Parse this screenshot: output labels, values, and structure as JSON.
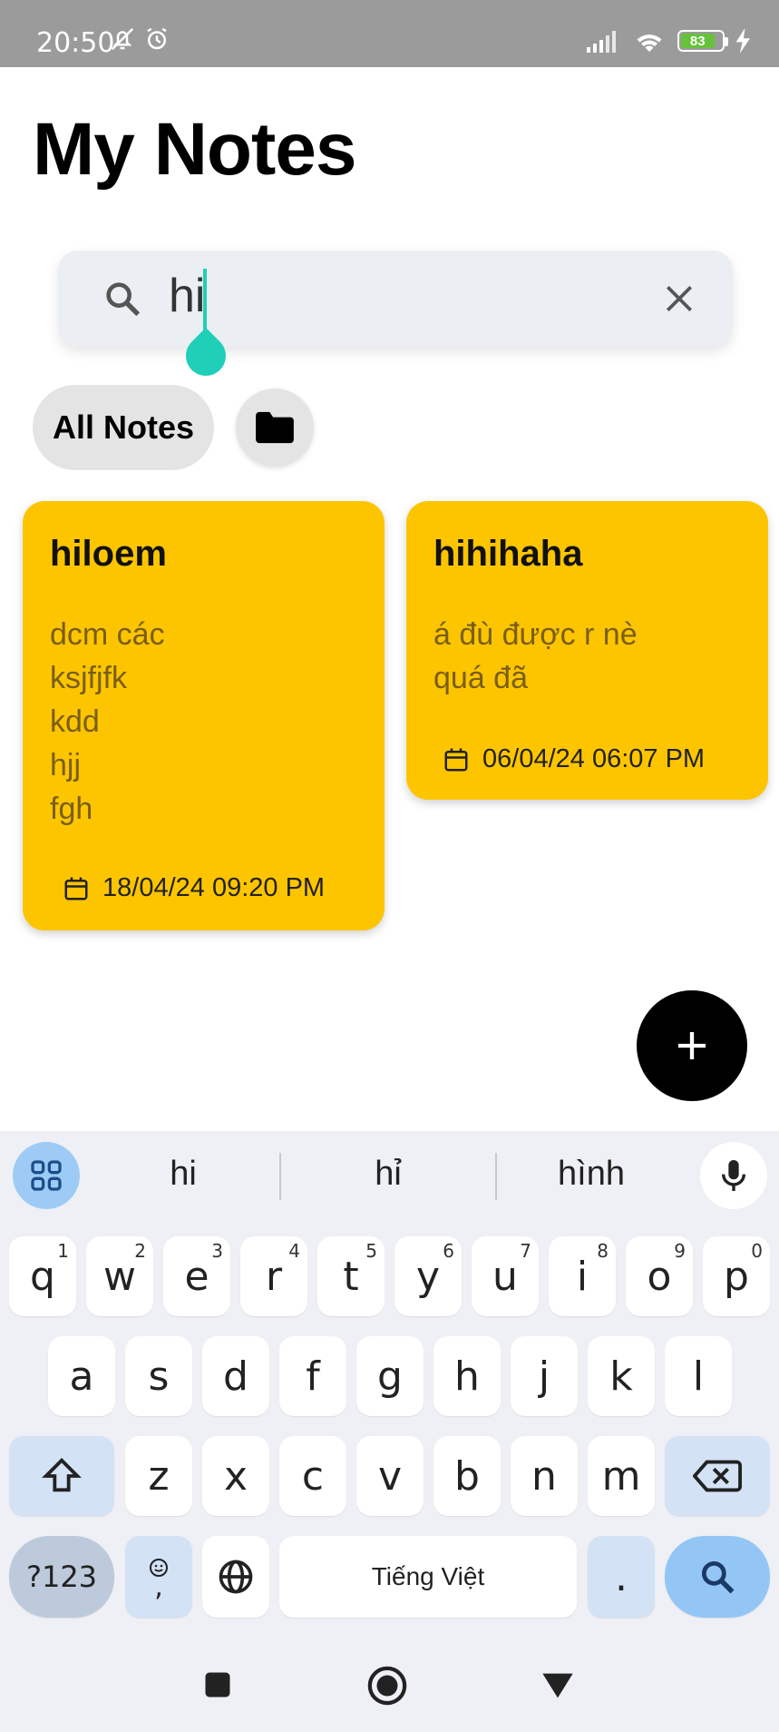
{
  "status_bar": {
    "time": "20:50",
    "battery_level": "83",
    "icons": [
      "bell-off-icon",
      "alarm-icon",
      "signal-icon",
      "wifi-icon",
      "battery-icon",
      "charging-icon"
    ]
  },
  "header": {
    "title": "My Notes"
  },
  "search": {
    "query": "hi"
  },
  "filters": {
    "all_label": "All Notes"
  },
  "notes": [
    {
      "title": "hiloem",
      "body": "dcm các\nksjfjfk\nkdd\n hjj\nfgh",
      "date": "18/04/24 09:20 PM"
    },
    {
      "title": "hihihaha",
      "body": "á đù được r nè\nquá đã",
      "date": "06/04/24 06:07 PM"
    }
  ],
  "colors": {
    "note_card": "#fdc500",
    "accent": "#1fcfb8",
    "fab": "#000000"
  },
  "keyboard": {
    "suggestions": [
      "hi",
      "hỉ",
      "hình"
    ],
    "row1": [
      {
        "k": "q",
        "n": "1"
      },
      {
        "k": "w",
        "n": "2"
      },
      {
        "k": "e",
        "n": "3"
      },
      {
        "k": "r",
        "n": "4"
      },
      {
        "k": "t",
        "n": "5"
      },
      {
        "k": "y",
        "n": "6"
      },
      {
        "k": "u",
        "n": "7"
      },
      {
        "k": "i",
        "n": "8"
      },
      {
        "k": "o",
        "n": "9"
      },
      {
        "k": "p",
        "n": "0"
      }
    ],
    "row2": [
      "a",
      "s",
      "d",
      "f",
      "g",
      "h",
      "j",
      "k",
      "l"
    ],
    "row3": [
      "z",
      "x",
      "c",
      "v",
      "b",
      "n",
      "m"
    ],
    "symbols_label": "?123",
    "comma_label": ",",
    "space_label": "Tiếng Việt",
    "period_label": "."
  }
}
